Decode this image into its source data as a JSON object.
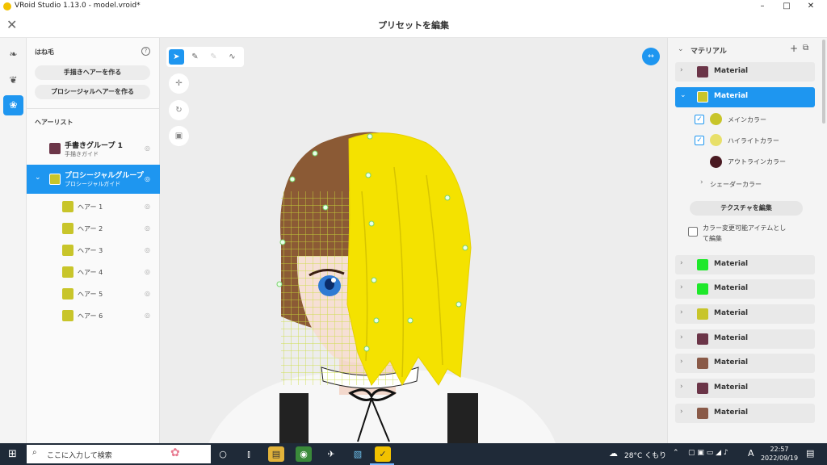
{
  "window": {
    "title": "VRoid Studio 1.13.0 - model.vroid*",
    "min": "–",
    "max": "□",
    "close": "✕"
  },
  "header": {
    "close_icon": "✕",
    "title": "プリセットを編集"
  },
  "left": {
    "section_title": "はね毛",
    "help": "?",
    "btn_handdrawn": "手描きヘアーを作る",
    "btn_procedural": "プロシージャルヘアーを作る",
    "list_title": "ヘアーリスト",
    "groups": [
      {
        "name": "手書きグループ 1",
        "sub": "手描きガイド",
        "color": "#6b3548"
      },
      {
        "name": "プロシージャルグループ",
        "sub": "プロシージャルガイド",
        "color": "#c8c52a"
      }
    ],
    "children": [
      "ヘアー 1",
      "ヘアー 2",
      "ヘアー 3",
      "ヘアー 4",
      "ヘアー 5",
      "ヘアー 6"
    ],
    "child_color": "#c8c52a"
  },
  "right": {
    "title": "マテリアル",
    "add": "+",
    "dup": "⧉",
    "materials": [
      {
        "label": "Material",
        "color": "#6b3548"
      },
      {
        "label": "Material",
        "color": "#c8c52a"
      },
      {
        "label": "Material",
        "color": "#1ee82a"
      },
      {
        "label": "Material",
        "color": "#1ee82a"
      },
      {
        "label": "Material",
        "color": "#c8c52a"
      },
      {
        "label": "Material",
        "color": "#6b3548"
      },
      {
        "label": "Material",
        "color": "#8a5a48"
      },
      {
        "label": "Material",
        "color": "#6b3548"
      },
      {
        "label": "Material",
        "color": "#8a5a48"
      }
    ],
    "main_color_label": "メインカラー",
    "highlight_label": "ハイライトカラー",
    "outline_label": "アウトラインカラー",
    "shader_label": "シェーダーカラー",
    "texture_btn": "テクスチャを編集",
    "color_change_label_1": "カラー変更可能アイテムとし",
    "color_change_label_2": "て編集",
    "colors": {
      "main": "#c8c52a",
      "highlight": "#e8e06a",
      "outline": "#4a1a22"
    }
  },
  "taskbar": {
    "search_placeholder": "ここに入力して検索",
    "weather": "28°C くもり",
    "time": "22:57",
    "date": "2022/09/19",
    "ime": "A"
  }
}
